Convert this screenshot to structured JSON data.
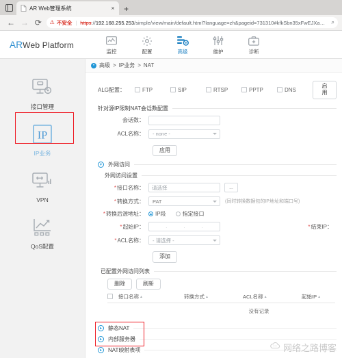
{
  "browser": {
    "tab": {
      "title": "AR Web管理系统",
      "close_label": "×",
      "new_tab_label": "+"
    },
    "nav": {
      "back": "←",
      "forward": "→",
      "reload": "⟳"
    },
    "omnibox": {
      "warning_text": "不安全",
      "url_scheme": "https",
      "url_separator": "://",
      "url_host": "192.168.255.253",
      "url_path": "/simple/view/main/default.html?language=zh&pageid=731310#kfkSbn35xFwEJXa5RMwHYWja6...",
      "zoom_icon": "⌕"
    }
  },
  "header": {
    "logo_ar": "AR",
    "logo_rest": "Web Platform",
    "nav_items": [
      {
        "label": "监控",
        "icon": "monitor-icon",
        "active": false
      },
      {
        "label": "配置",
        "icon": "gear-icon",
        "active": false
      },
      {
        "label": "高级",
        "icon": "advanced-icon",
        "active": true
      },
      {
        "label": "维护",
        "icon": "sliders-icon",
        "active": false
      },
      {
        "label": "诊断",
        "icon": "briefcase-icon",
        "active": false
      }
    ]
  },
  "sidebar": {
    "items": [
      {
        "label": "接口管理",
        "icon": "interface-icon",
        "active": false
      },
      {
        "label": "IP业务",
        "icon": "ip-icon",
        "active": true
      },
      {
        "label": "VPN",
        "icon": "vpn-icon",
        "active": false
      },
      {
        "label": "QoS配置",
        "icon": "qos-icon",
        "active": false
      }
    ]
  },
  "breadcrumb": {
    "crumb1": "高级",
    "sep1": ">",
    "crumb2": "IP业务",
    "sep2": ">",
    "crumb3": "NAT"
  },
  "alg": {
    "label": "ALG配置：",
    "options": [
      {
        "label": "FTP",
        "checked": false
      },
      {
        "label": "SIP",
        "checked": false
      },
      {
        "label": "RTSP",
        "checked": false
      },
      {
        "label": "PPTP",
        "checked": false
      },
      {
        "label": "DNS",
        "checked": false
      }
    ],
    "apply_label": "启用"
  },
  "session_limit": {
    "title": "针对源IP限制NAT会话数配置",
    "session_count_label": "会话数：",
    "session_count_value": "",
    "session_count_placeholder": "",
    "acl_label": "ACL名称：",
    "acl_value": "- none -",
    "apply_label": "应用"
  },
  "wan_access": {
    "section_title": "外网访问",
    "sub_title": "外网访问设置",
    "interface_label": "接口名称：",
    "interface_value": "请选择",
    "interface_browse_label": "...",
    "translate_label": "转换方式：",
    "translate_value": "PAT",
    "translate_hint": "(同时转换数据包的IP地址和端口号)",
    "src_addr_label": "转换后源地址：",
    "src_addr_options": [
      {
        "label": "IP段",
        "selected": true
      },
      {
        "label": "指定接口",
        "selected": false
      }
    ],
    "start_ip_label": "起始IP：",
    "start_ip_value": "",
    "end_ip_label": "结束IP：",
    "acl_label": "ACL名称：",
    "acl_value": "- 请选择 -",
    "add_label": "添加"
  },
  "wan_table": {
    "title": "已配置外网访问列表",
    "delete_label": "删除",
    "refresh_label": "刷新",
    "columns": [
      "接口名称",
      "转换方式",
      "ACL名称",
      "起始IP"
    ],
    "sort_caret": "▴",
    "empty_text": "没有记录",
    "rows": []
  },
  "collapsed_sections": [
    {
      "label": "静态NAT",
      "expander": "▸"
    },
    {
      "label": "内部服务器",
      "expander": "▸"
    },
    {
      "label": "NAT映射表项",
      "expander": "▸"
    }
  ],
  "watermark": {
    "text": "网络之路博客"
  },
  "colors": {
    "accent": "#2196d6",
    "logo_blue": "#2f8fd0",
    "highlight_red": "#ee1c25",
    "required_red": "#e05252",
    "warn_red": "#d93025"
  }
}
